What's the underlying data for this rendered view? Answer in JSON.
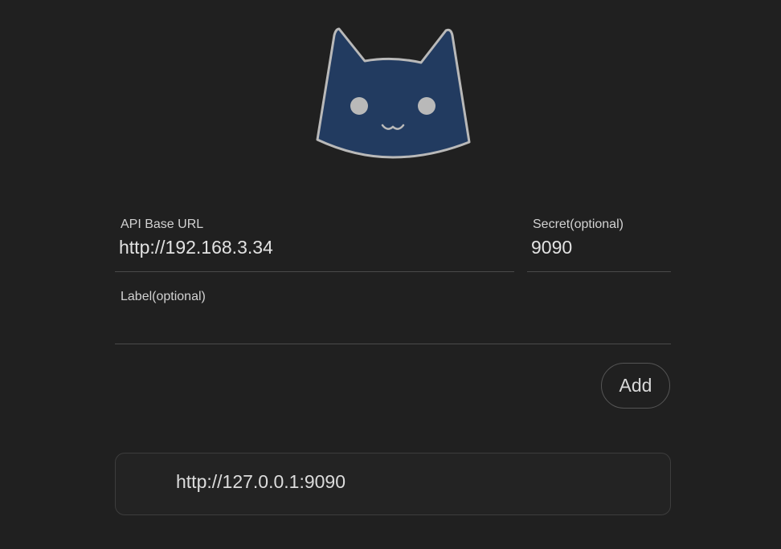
{
  "logo": {
    "icon": "cat-face-icon",
    "fill_color": "#223b60",
    "stroke_color": "#b9b9b9"
  },
  "form": {
    "api_base_url": {
      "label": "API Base URL",
      "value": "http://192.168.3.34",
      "placeholder": ""
    },
    "secret": {
      "label": "Secret(optional)",
      "value": "9090",
      "placeholder": ""
    },
    "label": {
      "label": "Label(optional)",
      "value": "",
      "placeholder": ""
    },
    "add_button_label": "Add"
  },
  "backends": [
    {
      "url": "http://127.0.0.1:9090"
    }
  ]
}
